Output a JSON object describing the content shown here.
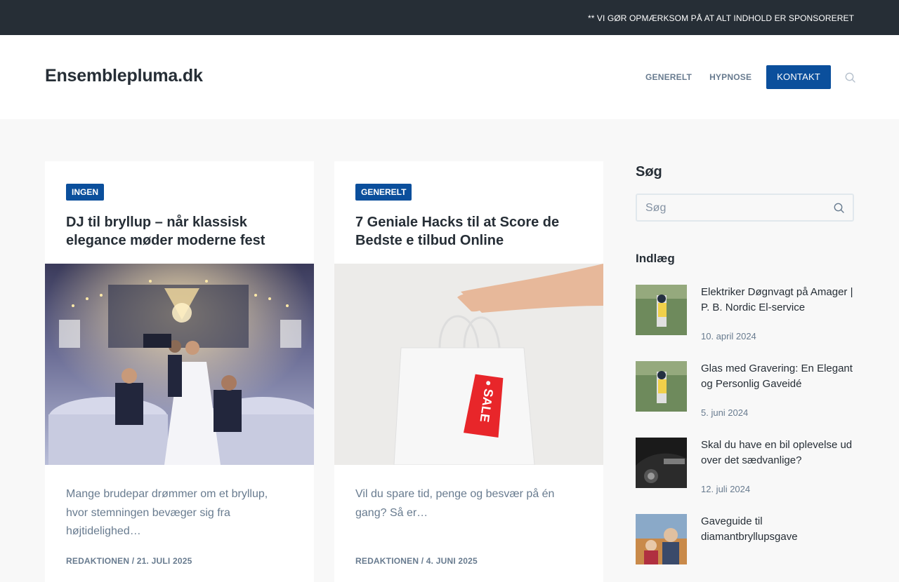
{
  "topbar": {
    "notice": "** VI GØR OPMÆRKSOM PÅ AT ALT INDHOLD ER SPONSORERET"
  },
  "header": {
    "site_title": "Ensemblepluma.dk",
    "nav": [
      {
        "label": "GENERELT"
      },
      {
        "label": "HYPNOSE"
      },
      {
        "label": "KONTAKT"
      }
    ]
  },
  "articles": [
    {
      "category": "INGEN",
      "title": "DJ til bryllup – når klassisk elegance møder moderne fest",
      "excerpt": "Mange brudepar drømmer om et bryllup, hvor stemningen bevæger sig fra højtidelighed…",
      "meta": "REDAKTIONEN  /  21. JULI 2025"
    },
    {
      "category": "GENERELT",
      "title": "7 Geniale Hacks til at Score de Bedste e tilbud Online",
      "excerpt": "Vil du spare tid, penge og besvær på én gang? Så er…",
      "meta": "REDAKTIONEN  /  4. JUNI 2025",
      "image_text": "SALE"
    }
  ],
  "sidebar": {
    "search_heading": "Søg",
    "search_placeholder": "Søg",
    "posts_heading": "Indlæg",
    "posts": [
      {
        "title": "Elektriker Døgnvagt på Amager | P. B. Nordic El-service",
        "date": "10. april 2024"
      },
      {
        "title": "Glas med Gravering: En Elegant og Personlig Gaveidé",
        "date": "5. juni 2024"
      },
      {
        "title": "Skal du have en bil oplevelse ud over det sædvanlige?",
        "date": "12. juli 2024"
      },
      {
        "title": "Gaveguide til diamantbryllupsgave",
        "date": ""
      }
    ]
  },
  "colors": {
    "primary": "#0b4f9c",
    "topbar": "#262e36",
    "text": "#262e36",
    "muted": "#687b8f"
  }
}
